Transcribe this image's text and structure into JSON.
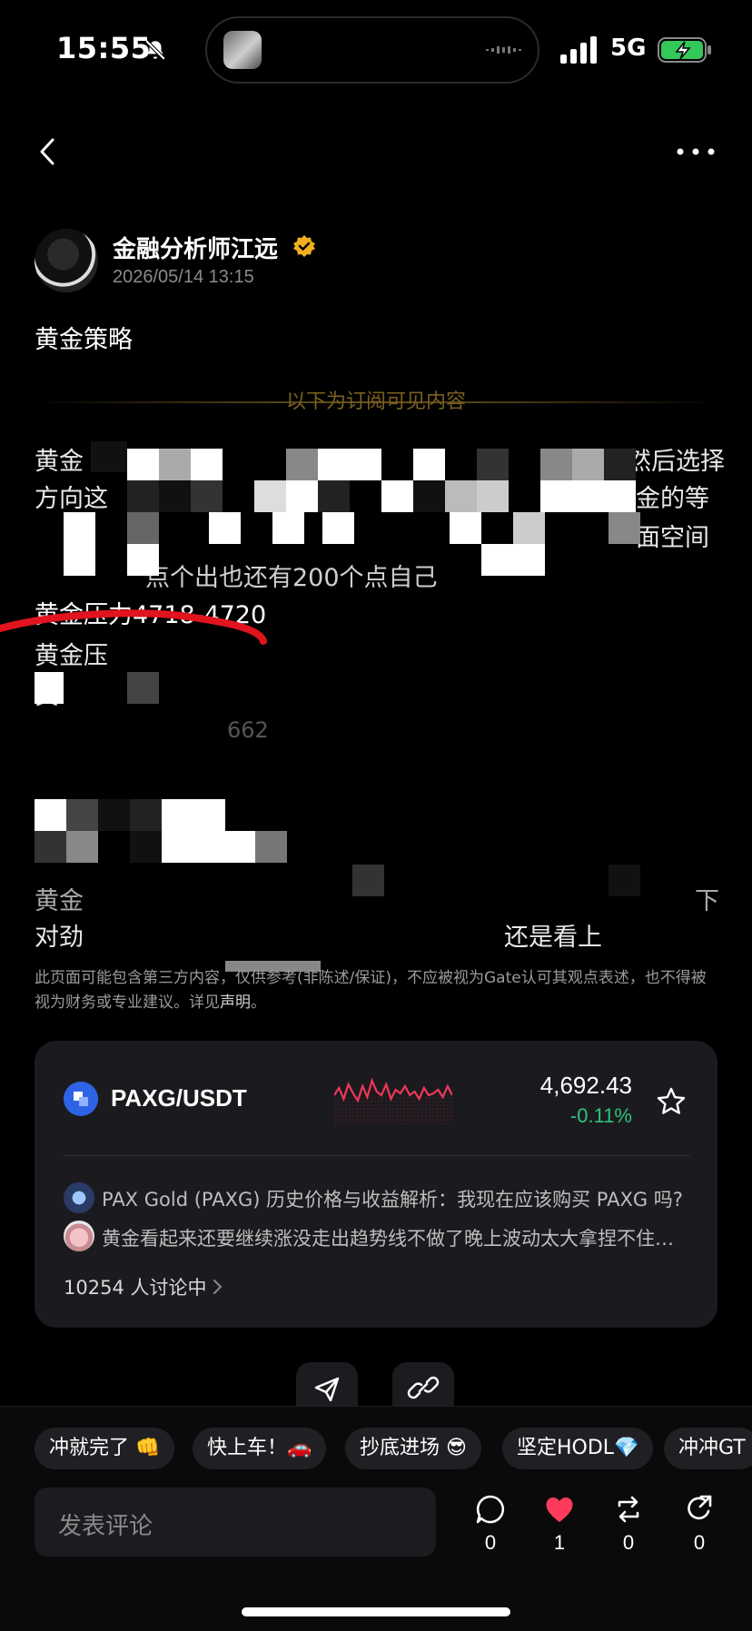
{
  "status_bar": {
    "time": "15:55",
    "network": "5G",
    "icons": [
      "bell-slash-icon",
      "signal-icon",
      "battery-charging-icon"
    ]
  },
  "nav": {
    "back_icon": "chevron-left-icon",
    "more_icon": "more-horizontal-icon"
  },
  "author": {
    "name": "金融分析师江远",
    "verified_icon": "verified-badge-icon",
    "date": "2026/05/14 13:15"
  },
  "post": {
    "title": "黄金策略",
    "subscription_notice": "以下为订阅可见内容",
    "fragments": {
      "l1a": "黄金",
      "l1b": "然后选择",
      "l2a": "方向这",
      "l2b": "金的等",
      "l3b": "面空间",
      "l4": "点个出也还有200个点自己",
      "l5": "黄金压力4718-4720",
      "l6": "黄金压",
      "l7": "黄",
      "l8": "662",
      "l10a": "黄金",
      "l10b": "下",
      "l11a": "对劲",
      "l11b": "还是看上"
    },
    "disclaimer": "此页面可能包含第三方内容，仅供参考(非陈述/保证)，不应被视为Gate认可其观点表述，也不得被视为财务或专业建议。详见",
    "disclaimer_link": "声明",
    "disclaimer_end": "。"
  },
  "coin_card": {
    "pair": "PAXG/USDT",
    "price": "4,692.43",
    "change": "-0.11%",
    "change_color": "#2ec27e",
    "spark_color": "#f0375a",
    "related": [
      "PAX Gold (PAXG) 历史价格与收益解析：我现在应该购买 PAXG 吗?",
      "黄金看起来还要继续涨没走出趋势线不做了晚上波动太大拿捏不住…"
    ],
    "discuss_count": "10254 人讨论中"
  },
  "quick_replies": [
    "冲就完了 👊",
    "快上车！🚗",
    "抄底进场 😎",
    "坚定HODL💎",
    "冲冲GT"
  ],
  "comment": {
    "placeholder": "发表评论"
  },
  "actions": {
    "comments": "0",
    "likes": "1",
    "reposts": "0",
    "shares": "0",
    "like_color": "#ff3b5c"
  }
}
